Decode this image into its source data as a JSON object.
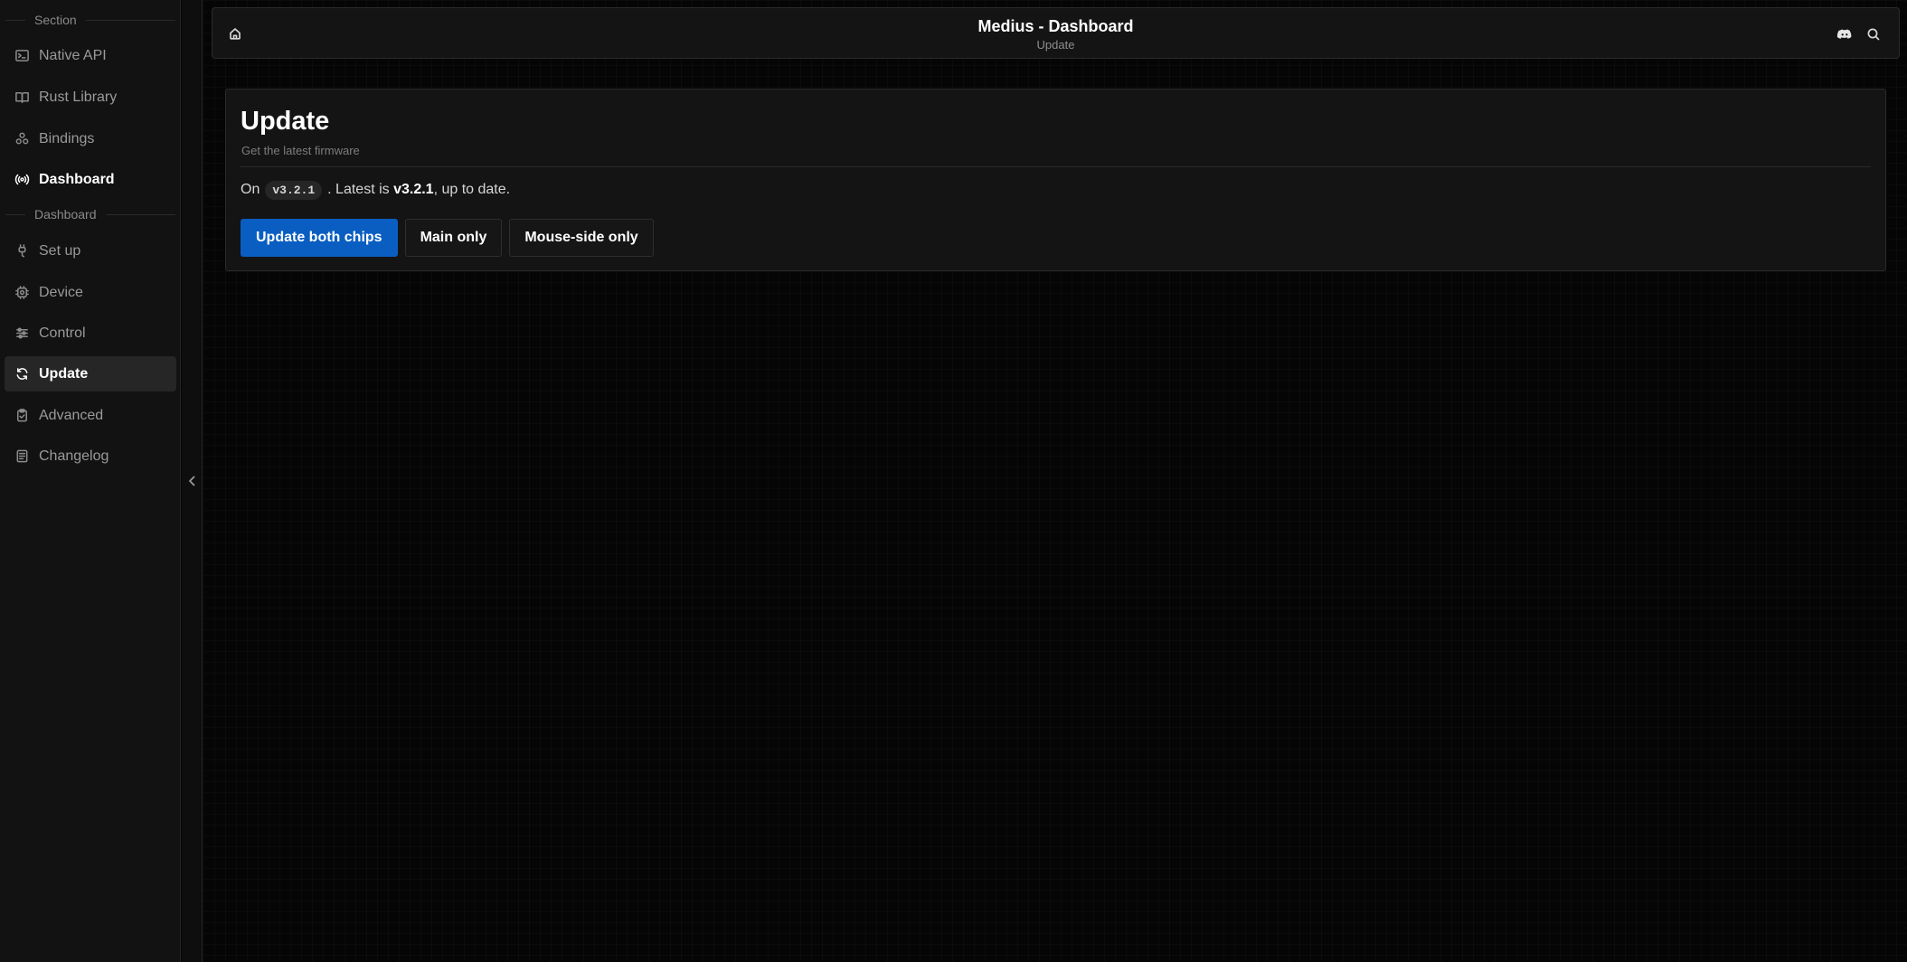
{
  "sidebar": {
    "section_title": "Section",
    "top_items": [
      {
        "label": "Native API",
        "icon": "terminal-icon"
      },
      {
        "label": "Rust Library",
        "icon": "book-icon"
      },
      {
        "label": "Bindings",
        "icon": "molecule-icon"
      },
      {
        "label": "Dashboard",
        "icon": "broadcast-icon"
      }
    ],
    "subsection_title": "Dashboard",
    "sub_items": [
      {
        "label": "Set up",
        "icon": "plug-icon"
      },
      {
        "label": "Device",
        "icon": "chip-icon"
      },
      {
        "label": "Control",
        "icon": "sliders-icon"
      },
      {
        "label": "Update",
        "icon": "refresh-icon"
      },
      {
        "label": "Advanced",
        "icon": "clipboard-icon"
      },
      {
        "label": "Changelog",
        "icon": "document-icon"
      }
    ]
  },
  "topbar": {
    "title": "Medius - Dashboard",
    "subtitle": "Update"
  },
  "page": {
    "heading": "Update",
    "description": "Get the latest firmware",
    "status_prefix": "On",
    "current_version": "v3.2.1",
    "status_middle": ". Latest is ",
    "latest_version": "v3.2.1",
    "status_suffix": ", up to date."
  },
  "actions": {
    "update_both": "Update both chips",
    "main_only": "Main only",
    "mouse_side_only": "Mouse-side only"
  },
  "colors": {
    "accent": "#0a5ec2",
    "background": "#050505",
    "panel": "#141414"
  }
}
